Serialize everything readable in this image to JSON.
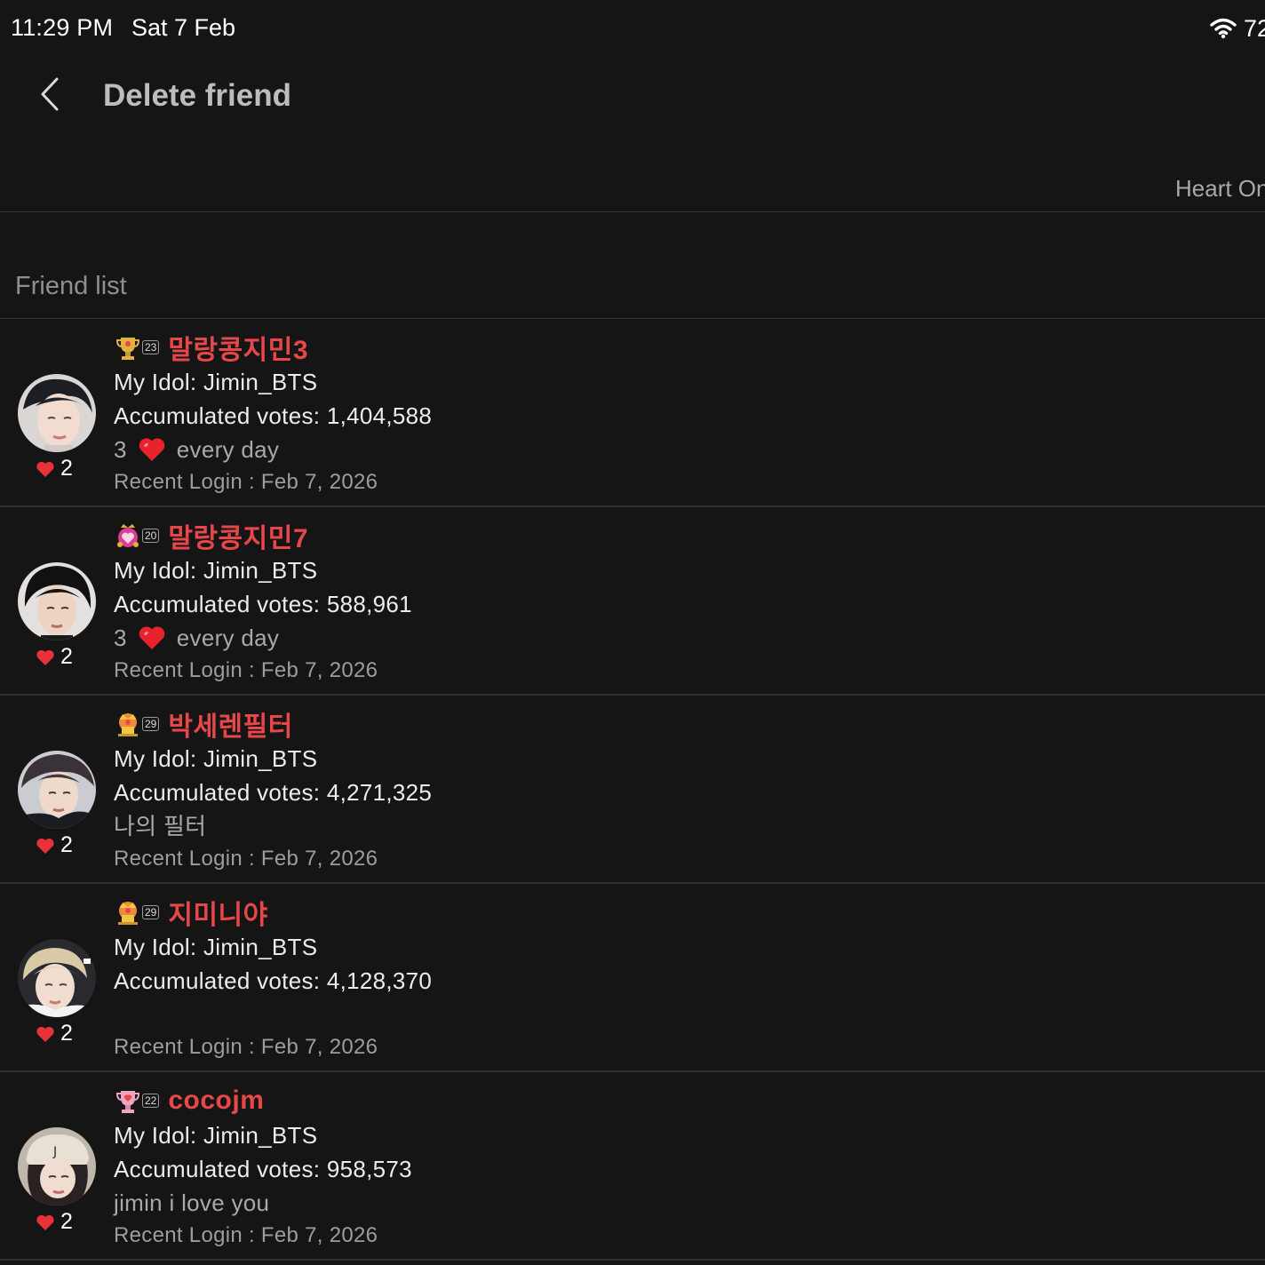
{
  "status_bar": {
    "time": "11:29 PM",
    "date": "Sat 7 Feb",
    "battery": "72"
  },
  "header": {
    "title": "Delete friend",
    "tab_label": "Heart On"
  },
  "section": {
    "title": "Friend list"
  },
  "colors": {
    "background": "#151515",
    "name_red": "#e8474a",
    "heart_red": "#e8323a"
  },
  "friends": [
    {
      "name": "말랑콩지민3",
      "level": "23",
      "level_icon": "trophy-icon",
      "idol": "My Idol: Jimin_BTS",
      "votes": "Accumulated votes: 1,404,588",
      "message_prefix": "3",
      "message_suffix": "every day",
      "message_plain": "",
      "recent_login": "Recent Login : Feb 7, 2026",
      "hearts": "2"
    },
    {
      "name": "말랑콩지민7",
      "level": "20",
      "level_icon": "heart-crown-icon",
      "idol": "My Idol: Jimin_BTS",
      "votes": "Accumulated votes: 588,961",
      "message_prefix": "3",
      "message_suffix": "every day",
      "message_plain": "",
      "recent_login": "Recent Login : Feb 7, 2026",
      "hearts": "2"
    },
    {
      "name": "박세렌필터",
      "level": "29",
      "level_icon": "crown-icon",
      "idol": "My Idol: Jimin_BTS",
      "votes": "Accumulated votes: 4,271,325",
      "message_prefix": "",
      "message_suffix": "",
      "message_plain": "나의 필터",
      "recent_login": "Recent Login : Feb 7, 2026",
      "hearts": "2"
    },
    {
      "name": "지미니야",
      "level": "29",
      "level_icon": "crown-icon",
      "idol": "My Idol: Jimin_BTS",
      "votes": "Accumulated votes: 4,128,370",
      "message_prefix": "",
      "message_suffix": "",
      "message_plain": "",
      "recent_login": "Recent Login : Feb 7, 2026",
      "hearts": "2"
    },
    {
      "name": "cocojm",
      "level": "22",
      "level_icon": "heart-trophy-icon",
      "idol": "My Idol: Jimin_BTS",
      "votes": "Accumulated votes: 958,573",
      "message_prefix": "",
      "message_suffix": "",
      "message_plain": "jimin i love you",
      "recent_login": "Recent Login : Feb 7, 2026",
      "hearts": "2"
    }
  ]
}
